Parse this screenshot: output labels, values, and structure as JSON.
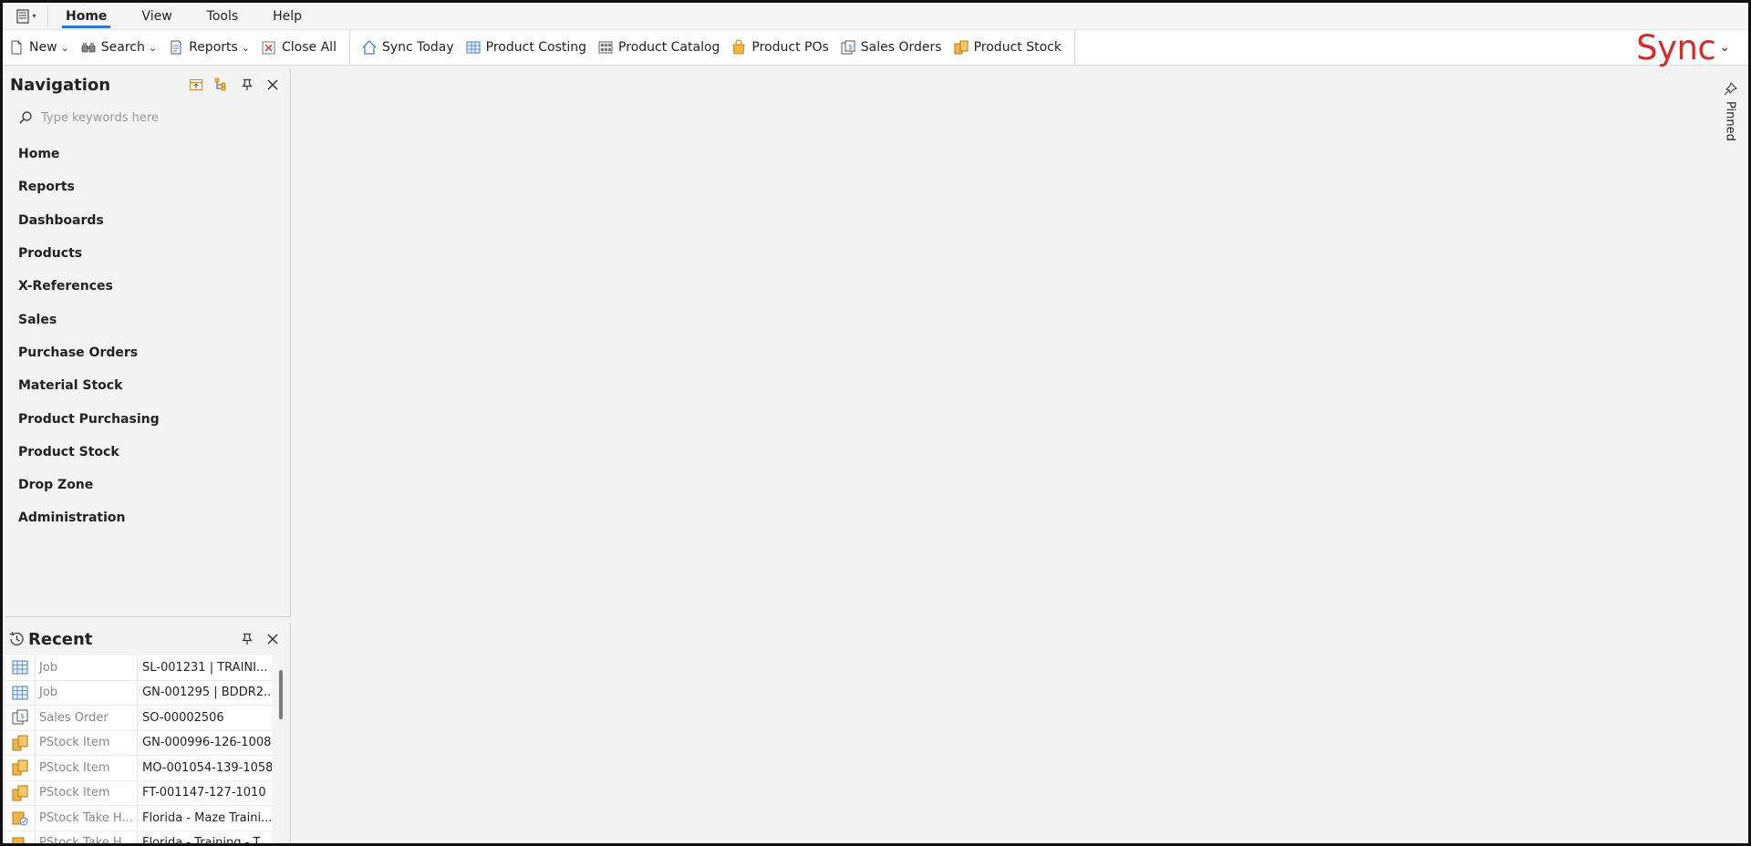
{
  "menubar": {
    "tabs": [
      {
        "label": "Home",
        "active": true
      },
      {
        "label": "View",
        "active": false
      },
      {
        "label": "Tools",
        "active": false
      },
      {
        "label": "Help",
        "active": false
      }
    ]
  },
  "toolbar": {
    "new_label": "New",
    "search_label": "Search",
    "reports_label": "Reports",
    "close_all_label": "Close All",
    "sync_today_label": "Sync Today",
    "product_costing_label": "Product Costing",
    "product_catalog_label": "Product Catalog",
    "product_pos_label": "Product POs",
    "sales_orders_label": "Sales Orders",
    "product_stock_label": "Product Stock"
  },
  "brand": {
    "logo_text": "Sync",
    "accent_color": "#d62b2b"
  },
  "navigation": {
    "title": "Navigation",
    "search_placeholder": "Type keywords here",
    "items": [
      {
        "label": "Home"
      },
      {
        "label": "Reports"
      },
      {
        "label": "Dashboards"
      },
      {
        "label": "Products"
      },
      {
        "label": "X-References"
      },
      {
        "label": "Sales"
      },
      {
        "label": "Purchase Orders"
      },
      {
        "label": "Material Stock"
      },
      {
        "label": "Product Purchasing"
      },
      {
        "label": "Product Stock"
      },
      {
        "label": "Drop Zone"
      },
      {
        "label": "Administration"
      }
    ]
  },
  "recent": {
    "title": "Recent",
    "rows": [
      {
        "icon": "grid-icon",
        "type": "Job",
        "name": "SL-001231 | TRAINI..."
      },
      {
        "icon": "grid-icon",
        "type": "Job",
        "name": "GN-001295 |  BDDR2..."
      },
      {
        "icon": "sales-order-icon",
        "type": "Sales Order",
        "name": "SO-00002506"
      },
      {
        "icon": "stock-box-icon",
        "type": "PStock Item",
        "name": "GN-000996-126-1008"
      },
      {
        "icon": "stock-box-icon",
        "type": "PStock Item",
        "name": "MO-001054-139-1058"
      },
      {
        "icon": "stock-box-icon",
        "type": "PStock Item",
        "name": "FT-001147-127-1010"
      },
      {
        "icon": "stock-take-icon",
        "type": "PStock Take H...",
        "name": "Florida - Maze Traini..."
      },
      {
        "icon": "stock-take-icon",
        "type": "PStock Take H...",
        "name": "Florida - Training - T..."
      }
    ]
  },
  "pinned": {
    "label": "Pinned"
  }
}
